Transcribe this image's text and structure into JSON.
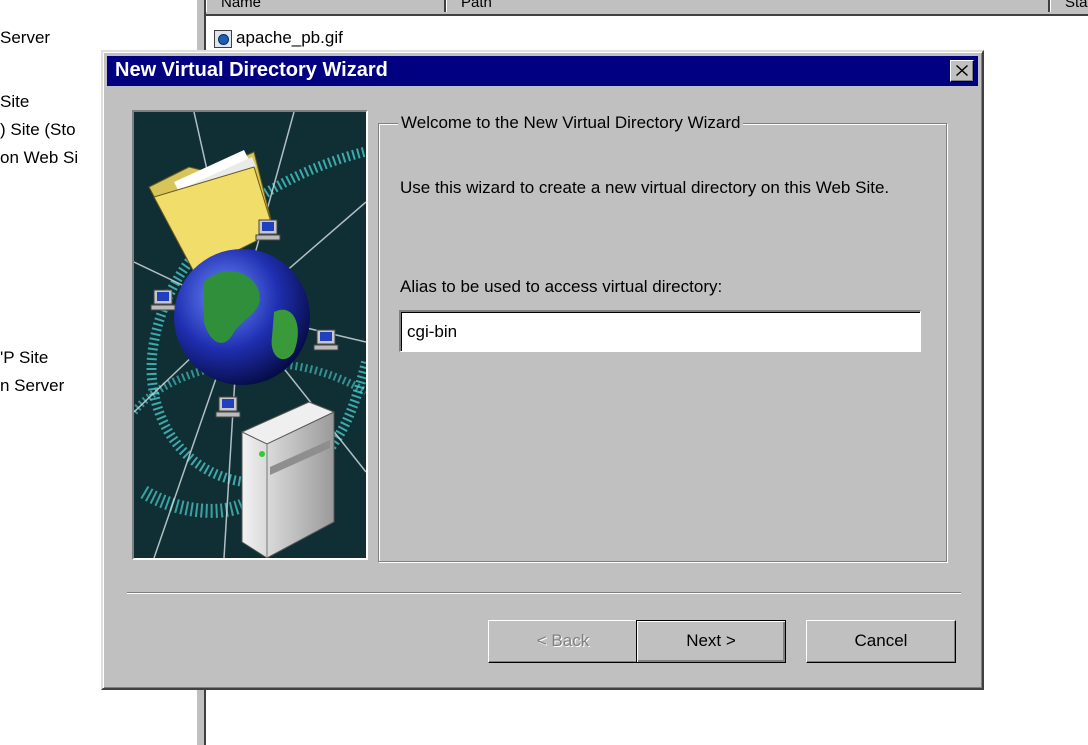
{
  "background": {
    "tree_items": [
      " Server",
      " Site",
      ") Site (Sto",
      "on Web Si",
      "'P Site",
      "n Server"
    ],
    "list_columns": [
      "Name",
      "Path",
      "Sta"
    ],
    "list_rows": [
      "apache_pb.gif"
    ]
  },
  "dialog": {
    "title": "New Virtual Directory Wizard",
    "welcome_heading": "Welcome to the New Virtual Directory Wizard",
    "description": "Use this wizard to create a new virtual directory on this Web Site.",
    "alias_label": "Alias to be used to access virtual directory:",
    "alias_value": "cgi-bin",
    "buttons": {
      "back": "< Back",
      "next": "Next >",
      "cancel": "Cancel"
    }
  },
  "icons": {
    "close": "close-icon",
    "art": "wizard-globe-network-illustration"
  },
  "colors": {
    "titlebar": "#000080",
    "face": "#c0c0c0",
    "art_background": "#0f2f34"
  }
}
